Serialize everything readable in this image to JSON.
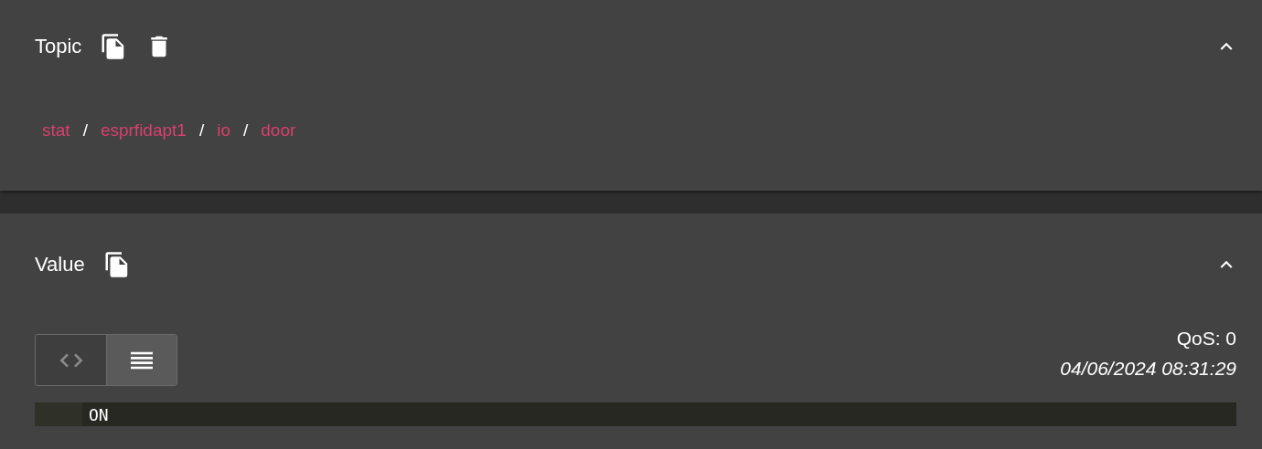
{
  "topic_panel": {
    "title": "Topic",
    "expanded": true,
    "actions": [
      {
        "kind": "copy"
      },
      {
        "kind": "delete"
      }
    ],
    "path": [
      {
        "kind": "segment",
        "text": "stat"
      },
      {
        "kind": "separator",
        "text": "/"
      },
      {
        "kind": "segment",
        "text": "esprfidapt1"
      },
      {
        "kind": "separator",
        "text": "/"
      },
      {
        "kind": "segment",
        "text": "io"
      },
      {
        "kind": "separator",
        "text": "/"
      },
      {
        "kind": "segment",
        "text": "door"
      }
    ]
  },
  "value_panel": {
    "title": "Value",
    "expanded": true,
    "actions": [
      {
        "kind": "copy"
      }
    ],
    "view_modes": [
      {
        "kind": "code",
        "selected": false
      },
      {
        "kind": "raw",
        "selected": true
      }
    ],
    "qos": "QoS: 0",
    "timestamp": "04/06/2024 08:31:29",
    "lines": [
      "ON"
    ]
  }
}
